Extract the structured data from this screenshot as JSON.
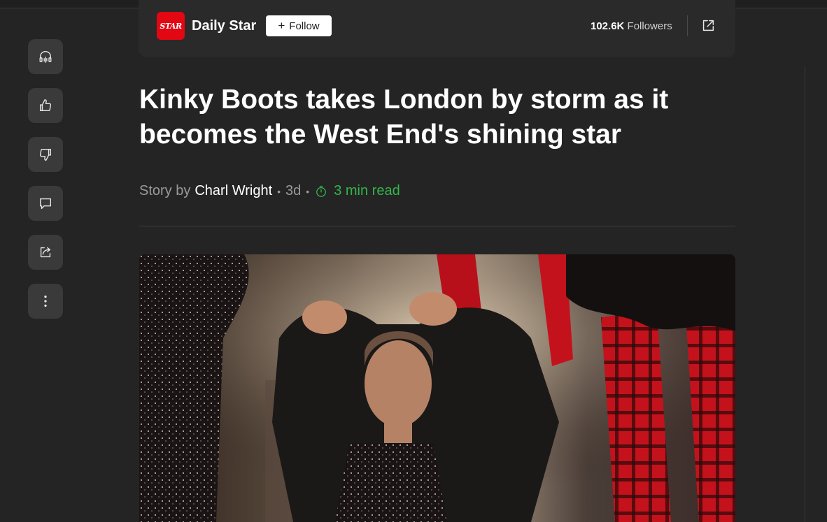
{
  "publisher": {
    "logo_text": "STAR",
    "name": "Daily Star",
    "follow_label": "Follow",
    "followers_count": "102.6K",
    "followers_label": "Followers"
  },
  "rail": {
    "icons": [
      "headphones-icon",
      "thumbs-up-icon",
      "thumbs-down-icon",
      "comment-icon",
      "share-icon",
      "more-icon"
    ]
  },
  "article": {
    "headline": "Kinky Boots takes London by storm as it becomes the West End's shining star",
    "byline_prefix": "Story by",
    "author": "Charl Wright",
    "age": "3d",
    "read_time": "3 min read"
  },
  "colors": {
    "background": "#242424",
    "accent_green": "#33b54a",
    "brand_red": "#e30613"
  }
}
